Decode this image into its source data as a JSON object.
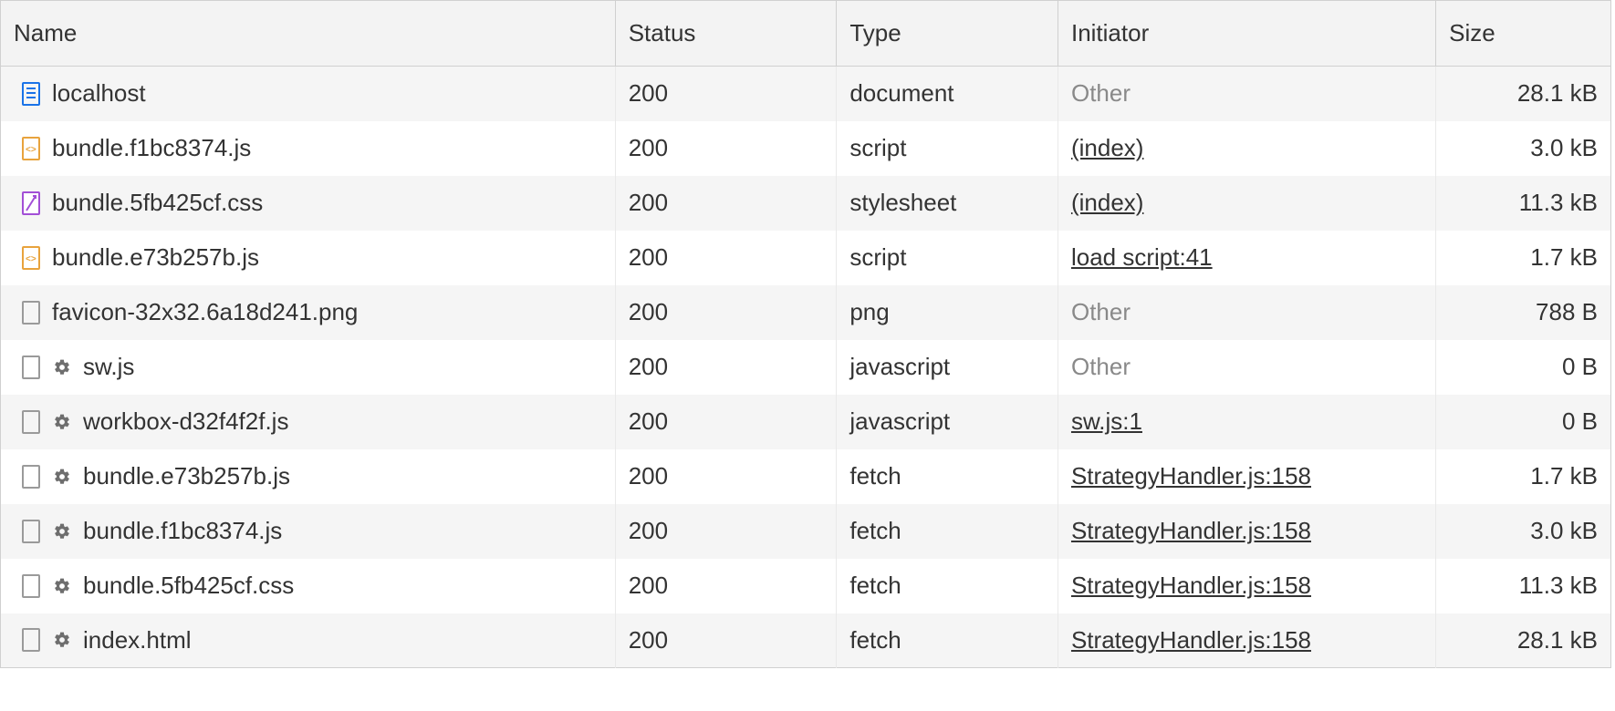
{
  "columns": {
    "name": "Name",
    "status": "Status",
    "type": "Type",
    "initiator": "Initiator",
    "size": "Size"
  },
  "rows": [
    {
      "icon": "document",
      "gear": false,
      "name": "localhost",
      "status": "200",
      "type": "document",
      "initiator": "Other",
      "initiator_link": false,
      "size": "28.1 kB"
    },
    {
      "icon": "js",
      "gear": false,
      "name": "bundle.f1bc8374.js",
      "status": "200",
      "type": "script",
      "initiator": "(index)",
      "initiator_link": true,
      "size": "3.0 kB"
    },
    {
      "icon": "css",
      "gear": false,
      "name": "bundle.5fb425cf.css",
      "status": "200",
      "type": "stylesheet",
      "initiator": "(index)",
      "initiator_link": true,
      "size": "11.3 kB"
    },
    {
      "icon": "js",
      "gear": false,
      "name": "bundle.e73b257b.js",
      "status": "200",
      "type": "script",
      "initiator": "load script:41",
      "initiator_link": true,
      "size": "1.7 kB"
    },
    {
      "icon": "blank",
      "gear": false,
      "name": "favicon-32x32.6a18d241.png",
      "status": "200",
      "type": "png",
      "initiator": "Other",
      "initiator_link": false,
      "size": "788 B"
    },
    {
      "icon": "blank",
      "gear": true,
      "name": "sw.js",
      "status": "200",
      "type": "javascript",
      "initiator": "Other",
      "initiator_link": false,
      "size": "0 B"
    },
    {
      "icon": "blank",
      "gear": true,
      "name": "workbox-d32f4f2f.js",
      "status": "200",
      "type": "javascript",
      "initiator": "sw.js:1",
      "initiator_link": true,
      "size": "0 B"
    },
    {
      "icon": "blank",
      "gear": true,
      "name": "bundle.e73b257b.js",
      "status": "200",
      "type": "fetch",
      "initiator": "StrategyHandler.js:158",
      "initiator_link": true,
      "size": "1.7 kB"
    },
    {
      "icon": "blank",
      "gear": true,
      "name": "bundle.f1bc8374.js",
      "status": "200",
      "type": "fetch",
      "initiator": "StrategyHandler.js:158",
      "initiator_link": true,
      "size": "3.0 kB"
    },
    {
      "icon": "blank",
      "gear": true,
      "name": "bundle.5fb425cf.css",
      "status": "200",
      "type": "fetch",
      "initiator": "StrategyHandler.js:158",
      "initiator_link": true,
      "size": "11.3 kB"
    },
    {
      "icon": "blank",
      "gear": true,
      "name": "index.html",
      "status": "200",
      "type": "fetch",
      "initiator": "StrategyHandler.js:158",
      "initiator_link": true,
      "size": "28.1 kB"
    }
  ]
}
